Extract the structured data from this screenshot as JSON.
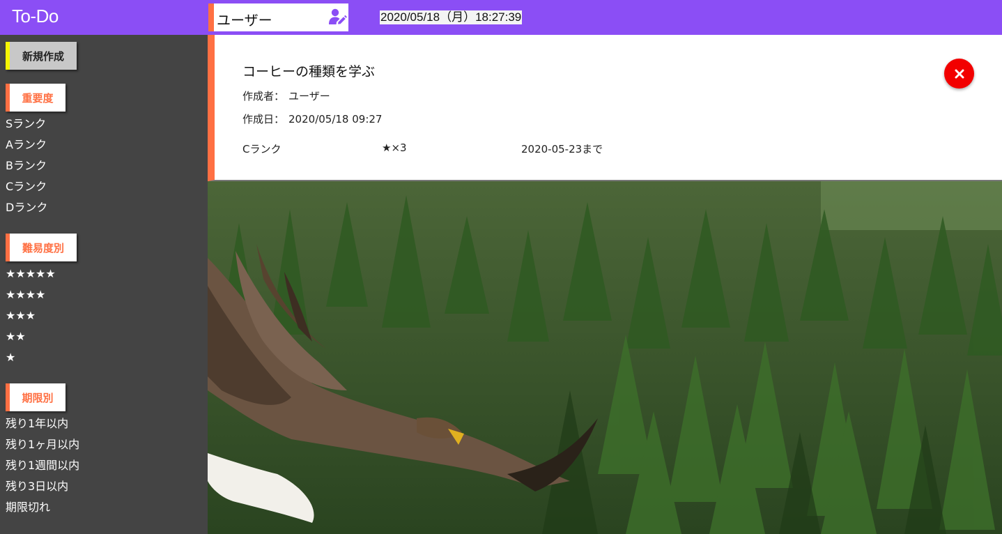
{
  "header": {
    "app_title": "To-Do",
    "user_name": "ユーザー",
    "datetime": "2020/05/18（月）18:27:39"
  },
  "sidebar": {
    "new_button": "新規作成",
    "importance": {
      "heading": "重要度",
      "items": [
        "Sランク",
        "Aランク",
        "Bランク",
        "Cランク",
        "Dランク"
      ]
    },
    "difficulty": {
      "heading": "難易度別",
      "items": [
        "★★★★★",
        "★★★★",
        "★★★",
        "★★",
        "★"
      ]
    },
    "deadline": {
      "heading": "期限別",
      "items": [
        "残り1年以内",
        "残り1ヶ月以内",
        "残り1週間以内",
        "残り3日以内",
        "期限切れ"
      ]
    }
  },
  "todo": {
    "title": "コーヒーの種類を学ぶ",
    "author_label": "作成者：",
    "author": "ユーザー",
    "created_label": "作成日：",
    "created": "2020/05/18 09:27",
    "rank": "Cランク",
    "difficulty": "★×3",
    "deadline": "2020-05-23まで"
  },
  "colors": {
    "header": "#8b4ef5",
    "accent": "#ff7043",
    "sidebar": "#444444",
    "new_button_accent": "#f6f600",
    "close_button": "#f20000"
  },
  "icons": {
    "user_edit": "user-edit-icon",
    "close": "close-icon"
  }
}
